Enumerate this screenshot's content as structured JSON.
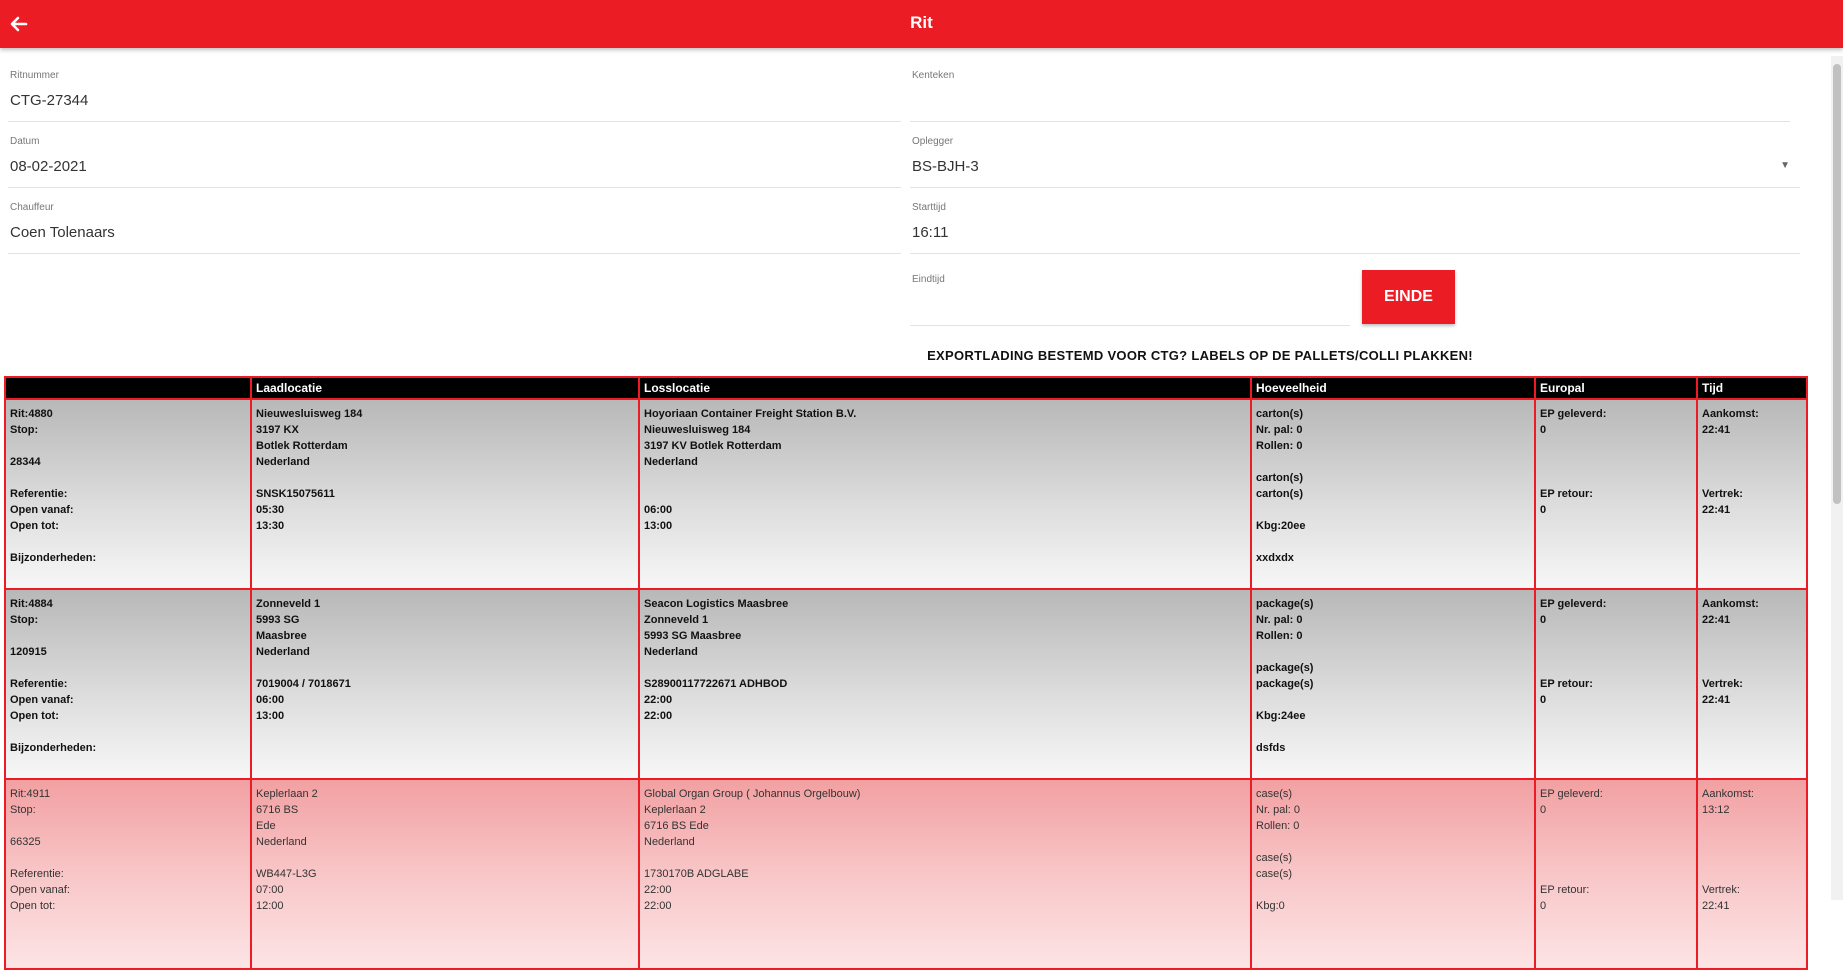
{
  "header": {
    "title": "Rit",
    "back_icon": "arrow-left-icon"
  },
  "form": {
    "ritnummer": {
      "label": "Ritnummer",
      "value": "CTG-27344"
    },
    "datum": {
      "label": "Datum",
      "value": "08-02-2021"
    },
    "chauffeur": {
      "label": "Chauffeur",
      "value": "Coen Tolenaars"
    },
    "kenteken": {
      "label": "Kenteken",
      "value": ""
    },
    "oplegger": {
      "label": "Oplegger",
      "value": "BS-BJH-3"
    },
    "starttijd": {
      "label": "Starttijd",
      "value": "16:11"
    },
    "eindtijd": {
      "label": "Eindtijd",
      "value": ""
    },
    "einde_button": "EINDE"
  },
  "notice": "EXPORTLADING BESTEMD VOOR CTG? LABELS OP DE PALLETS/COLLI PLAKKEN!",
  "table": {
    "headers": [
      "",
      "Laadlocatie",
      "Losslocatie",
      "Hoeveelheid",
      "Europal",
      "Tijd"
    ],
    "rows": [
      {
        "style": "grey",
        "info": [
          "Rit:4880",
          "Stop:",
          "",
          "28344",
          "",
          "Referentie:",
          "Open vanaf:",
          "Open tot:",
          "",
          "Bijzonderheden:"
        ],
        "laad": [
          "Nieuwesluisweg 184",
          "3197 KX",
          "Botlek Rotterdam",
          "Nederland",
          "",
          "SNSK15075611",
          "05:30",
          "13:30"
        ],
        "los": [
          "Hoyoriaan Container Freight Station B.V.",
          "Nieuwesluisweg 184",
          "3197 KV Botlek Rotterdam",
          "Nederland",
          "",
          "",
          "06:00",
          "13:00"
        ],
        "hoeveelheid": [
          "carton(s)",
          "Nr. pal: 0",
          "Rollen: 0",
          "",
          "carton(s)",
          "carton(s)",
          "",
          "Kbg:20ee",
          "",
          "xxdxdx"
        ],
        "europal": [
          "EP geleverd:",
          "0",
          "",
          "",
          "",
          "EP retour:",
          "0"
        ],
        "tijd": [
          "Aankomst:",
          "22:41",
          "",
          "",
          "",
          "Vertrek:",
          "22:41"
        ]
      },
      {
        "style": "grey",
        "info": [
          "Rit:4884",
          "Stop:",
          "",
          "120915",
          "",
          "Referentie:",
          "Open vanaf:",
          "Open tot:",
          "",
          "Bijzonderheden:"
        ],
        "laad": [
          "Zonneveld 1",
          "5993 SG",
          "Maasbree",
          "Nederland",
          "",
          "7019004 / 7018671",
          "06:00",
          "13:00"
        ],
        "los": [
          "Seacon Logistics Maasbree",
          "Zonneveld 1",
          "5993 SG Maasbree",
          "Nederland",
          "",
          "S28900117722671 ADHBOD",
          "22:00",
          "22:00"
        ],
        "hoeveelheid": [
          "package(s)",
          "Nr. pal: 0",
          "Rollen: 0",
          "",
          "package(s)",
          "package(s)",
          "",
          "Kbg:24ee",
          "",
          "dsfds"
        ],
        "europal": [
          "EP geleverd:",
          "0",
          "",
          "",
          "",
          "EP retour:",
          "0"
        ],
        "tijd": [
          "Aankomst:",
          "22:41",
          "",
          "",
          "",
          "Vertrek:",
          "22:41"
        ]
      },
      {
        "style": "pink",
        "info": [
          "Rit:4911",
          "Stop:",
          "",
          "66325",
          "",
          "Referentie:",
          "Open vanaf:",
          "Open tot:"
        ],
        "laad": [
          "Keplerlaan 2",
          "6716 BS",
          "Ede",
          "Nederland",
          "",
          "WB447-L3G",
          "07:00",
          "12:00"
        ],
        "los": [
          "Global Organ Group ( Johannus Orgelbouw)",
          "Keplerlaan 2",
          "6716 BS Ede",
          "Nederland",
          "",
          "1730170B ADGLABE",
          "22:00",
          "22:00"
        ],
        "hoeveelheid": [
          "case(s)",
          "Nr. pal: 0",
          "Rollen: 0",
          "",
          "case(s)",
          "case(s)",
          "",
          "Kbg:0"
        ],
        "europal": [
          "EP geleverd:",
          "0",
          "",
          "",
          "",
          "",
          "EP retour:",
          "0"
        ],
        "tijd": [
          "Aankomst:",
          "13:12",
          "",
          "",
          "",
          "",
          "Vertrek:",
          "22:41"
        ]
      }
    ]
  },
  "colors": {
    "brand": "#ec1c24",
    "header_text": "#ffffff"
  }
}
